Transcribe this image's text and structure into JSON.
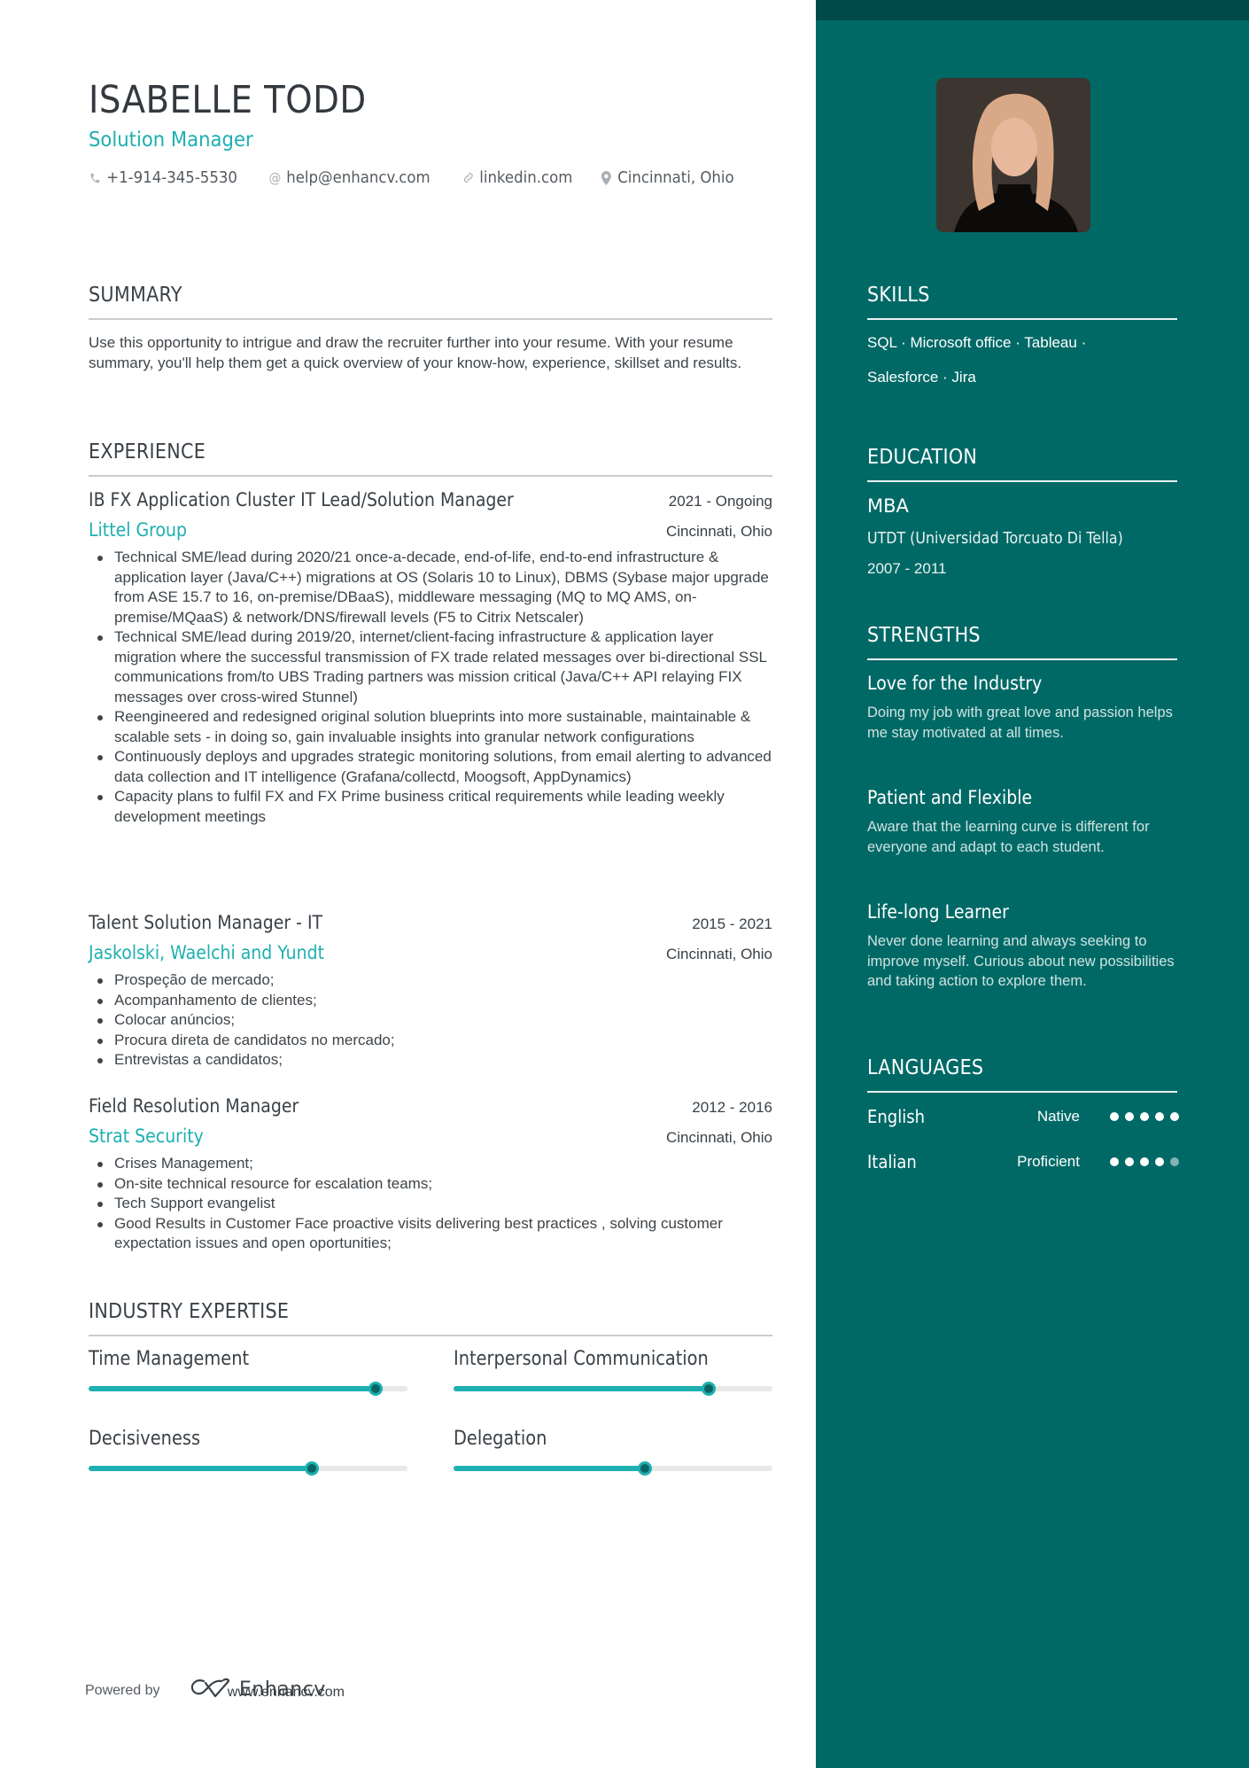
{
  "header": {
    "name": "ISABELLE TODD",
    "title": "Solution Manager",
    "contacts": [
      {
        "icon": "phone-icon",
        "glyph": "☎",
        "text": "+1-914-345-5530"
      },
      {
        "icon": "at-icon",
        "glyph": "@",
        "text": "help@enhancv.com"
      },
      {
        "icon": "link-icon",
        "glyph": "🔗",
        "text": "linkedin.com"
      },
      {
        "icon": "location-pin-icon",
        "glyph": "▾",
        "text": "Cincinnati, Ohio"
      }
    ]
  },
  "summary": {
    "title": "SUMMARY",
    "text": "Use this opportunity to intrigue and draw the recruiter further into your resume. With your resume summary, you'll help them get a quick overview of your know-how, experience, skillset and results."
  },
  "experience": {
    "title": "EXPERIENCE",
    "jobs": [
      {
        "role": "IB FX Application Cluster IT Lead/Solution Manager",
        "dates": "2021 - Ongoing",
        "company": "Littel Group",
        "location": "Cincinnati, Ohio",
        "bullets": [
          "Technical SME/lead during 2020/21 once-a-decade, end-of-life, end-to-end infrastructure & application layer (Java/C++) migrations at OS (Solaris 10 to Linux), DBMS (Sybase major upgrade from ASE 15.7 to 16, on-premise/DBaaS), middleware messaging (MQ to MQ AMS, on-premise/MQaaS) & network/DNS/firewall levels (F5 to Citrix Netscaler)",
          "Technical SME/lead during 2019/20, internet/client-facing infrastructure & application layer migration where the successful transmission of FX trade related messages over bi-directional SSL communications from/to UBS Trading partners was mission critical (Java/C++ API relaying FIX messages over cross-wired Stunnel)",
          "Reengineered and redesigned original solution blueprints into more sustainable, maintainable & scalable sets - in doing so, gain invaluable insights into granular network configurations",
          "Continuously deploys and upgrades strategic monitoring solutions, from email alerting to advanced data collection and IT intelligence (Grafana/collectd, Moogsoft, AppDynamics)",
          "Capacity plans to fulfil FX and FX Prime business critical requirements while leading weekly development meetings"
        ]
      },
      {
        "role": "Talent Solution Manager - IT",
        "dates": "2015 - 2021",
        "company": "Jaskolski, Waelchi and Yundt",
        "location": "Cincinnati, Ohio",
        "bullets": [
          "Prospeção de mercado;",
          "Acompanhamento de clientes;",
          "Colocar anúncios;",
          "Procura direta de candidatos no mercado;",
          "Entrevistas a candidatos;"
        ]
      },
      {
        "role": "Field Resolution Manager",
        "dates": "2012 - 2016",
        "company": "Strat Security",
        "location": "Cincinnati, Ohio",
        "bullets": [
          "Crises Management;",
          "On-site technical resource for escalation teams;",
          "Tech Support  evangelist",
          "Good Results in Customer Face proactive visits delivering best practices , solving customer expectation issues and open oportunities;"
        ]
      }
    ]
  },
  "expertise": {
    "title": "INDUSTRY EXPERTISE",
    "items": [
      {
        "name": "Time Management",
        "level": 0.9
      },
      {
        "name": "Interpersonal Communication",
        "level": 0.8
      },
      {
        "name": "Decisiveness",
        "level": 0.7
      },
      {
        "name": "Delegation",
        "level": 0.6
      }
    ]
  },
  "footer": {
    "powered_by": "Powered by",
    "brand": "Enhancv",
    "url": "www.enhancv.com"
  },
  "sidebar": {
    "skills": {
      "title": "SKILLS",
      "line1": "SQL · Microsoft office · Tableau ·",
      "line2": "Salesforce · Jira"
    },
    "education": {
      "title": "EDUCATION",
      "degree": "MBA",
      "school": "UTDT (Universidad Torcuato Di Tella)",
      "years": "2007 - 2011"
    },
    "strengths": {
      "title": "STRENGTHS",
      "items": [
        {
          "title": "Love for the Industry",
          "desc": "Doing my job with great love and passion helps me stay motivated at all times."
        },
        {
          "title": "Patient and Flexible",
          "desc": "Aware that the learning curve is different for everyone and adapt to each student."
        },
        {
          "title": "Life-long Learner",
          "desc": "Never done learning and always seeking to improve myself. Curious about new possibilities and taking action to explore them."
        }
      ]
    },
    "languages": {
      "title": "LANGUAGES",
      "items": [
        {
          "name": "English",
          "level": "Native",
          "rating": 5,
          "max": 5
        },
        {
          "name": "Italian",
          "level": "Proficient",
          "rating": 4,
          "max": 5
        }
      ]
    }
  },
  "colors": {
    "accent": "#1eafb0",
    "sidebar": "#006966",
    "sidebar_top": "#004a49",
    "text": "#3a4147"
  }
}
